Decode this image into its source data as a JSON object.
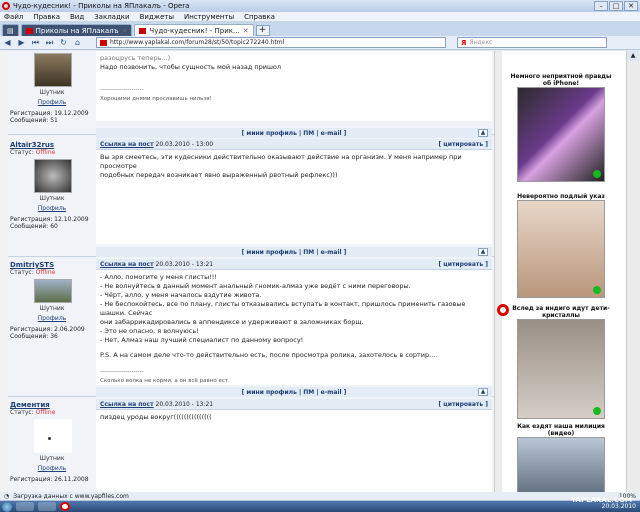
{
  "window": {
    "title": "Чудо-кудесник! - Приколы на ЯПлакалъ - Opera"
  },
  "menu": [
    "Файл",
    "Правка",
    "Вид",
    "Закладки",
    "Виджеты",
    "Инструменты",
    "Справка"
  ],
  "tabs": [
    {
      "label": "Приколы на ЯПлакалъ"
    },
    {
      "label": "Чудо-кудесник! - Прик..."
    }
  ],
  "address": {
    "url": "http://www.yaplakal.com/forum28/st/50/topic272240.html"
  },
  "search": {
    "placeholder": "Яндекс",
    "logo": "Я"
  },
  "posts": [
    {
      "username": "",
      "rank": "Шутник",
      "profile_link": "Профиль",
      "reg_label": "Регистрация: 19.12.2009",
      "msgs_label": "Сообщений: 51",
      "head_link": "",
      "head_date": "",
      "text": [
        "разоцрусь теперь...)",
        "Надо позвонить, чтобы сущность мой назад пришол"
      ],
      "signature": "Хорошими днями прославишь нильзя!",
      "footer": "[ мини профиль | ПМ | e-mail ]"
    },
    {
      "username": "Altair32rus",
      "status_label": "Статус:",
      "status": "Offline",
      "rank": "Шутник",
      "profile_link": "Профиль",
      "reg_label": "Регистрация: 12.10.2009",
      "msgs_label": "Сообщений: 60",
      "head_link": "Ссылка на пост",
      "head_date": "20.03.2010 - 13:00",
      "cite": "[ цитировать ]",
      "text": [
        "Вы зря смеетесь, эти кудесники действительно оказывают действие на организм. У меня например при просмотре",
        "подобных передач возникает явно выраженный рвотный рефлекс)))"
      ],
      "footer": "[ мини профиль | ПМ | e-mail ]"
    },
    {
      "username": "DmitriySTS",
      "status_label": "Статус:",
      "status": "Offline",
      "rank": "Шутник",
      "profile_link": "Профиль",
      "reg_label": "Регистрация: 2.06.2009",
      "msgs_label": "Сообщений: 36",
      "head_link": "Ссылка на пост",
      "head_date": "20.03.2010 - 13:21",
      "cite": "[ цитировать ]",
      "text": [
        "- Алло, помогите у меня глисты!!!",
        "- Не волнуйтесь в данный момент анальный гномик-алмаз уже ведёт с ними переговоры.",
        "- Чёрт, алло, у меня началось вздутие живота.",
        "- Не беспокойтесь, все по плану, глисты отказывались вступать в контакт, пришлось применить газовые шашки. Сейчас",
        "они забаррикадировались в аппендиксе и удерживают в заложниках борщ.",
        "- Это не опасно, я волнуюсь!",
        "- Нет, Алмаз наш лучший специалист по данному вопросу!",
        "",
        "P.S. А на самом деле что-то действительно есть, после просмотра ролика, захотелось в сортир...."
      ],
      "signature": "Сколько волка не корми, а он всё равно ест.",
      "footer": "[ мини профиль | ПМ | e-mail ]"
    },
    {
      "username": "Дементия",
      "status_label": "Статус:",
      "status": "Offline",
      "rank": "Шутник",
      "profile_link": "Профиль",
      "reg_label": "Регистрация: 26.11.2008",
      "msgs_label": "",
      "head_link": "Ссылка на пост",
      "head_date": "20.03.2010 - 13:21",
      "cite": "[ цитировать ]",
      "text": [
        "пиздец уроды вокруг((((((((((((((("
      ]
    }
  ],
  "ads": [
    {
      "title": "Немного неприятной правды об iPhone!"
    },
    {
      "title": "Невероятно подлый указ"
    },
    {
      "title": "Вслед за индиго идут дети-кристаллы"
    },
    {
      "title": "Как ездят наша милиция (видео)"
    }
  ],
  "status_bar": {
    "text": "Загрузка данных с www.yapfiles.com",
    "zoom": "100%"
  },
  "taskbar": {
    "date": "20.03.2010",
    "brand": "YAPLAKAL.COM"
  },
  "colors": {
    "accent": "#1d3f75",
    "offline": "#d33333",
    "online_dot": "#18b820"
  }
}
